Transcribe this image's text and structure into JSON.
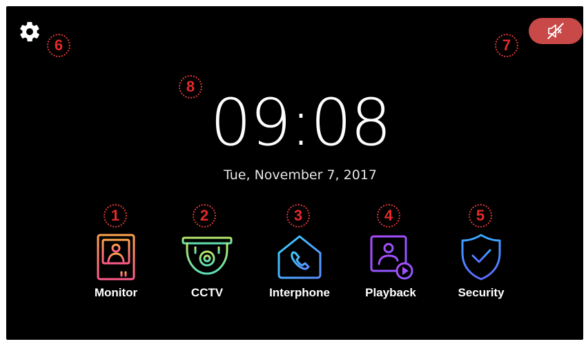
{
  "clock": {
    "time": "09:08",
    "date": "Tue, November 7, 2017"
  },
  "badges": [
    "1",
    "2",
    "3",
    "4",
    "5",
    "6",
    "7",
    "8"
  ],
  "apps": [
    {
      "label": "Monitor",
      "icon": "monitor-icon"
    },
    {
      "label": "CCTV",
      "icon": "cctv-camera-icon"
    },
    {
      "label": "Interphone",
      "icon": "house-phone-icon"
    },
    {
      "label": "Playback",
      "icon": "playback-icon"
    },
    {
      "label": "Security",
      "icon": "shield-check-icon"
    }
  ],
  "icons": {
    "settings": "gear-icon",
    "mute": "speaker-muted-icon"
  },
  "colors": {
    "background": "#000000",
    "mute_button": "#c94848",
    "badge": "#e23a3a"
  }
}
